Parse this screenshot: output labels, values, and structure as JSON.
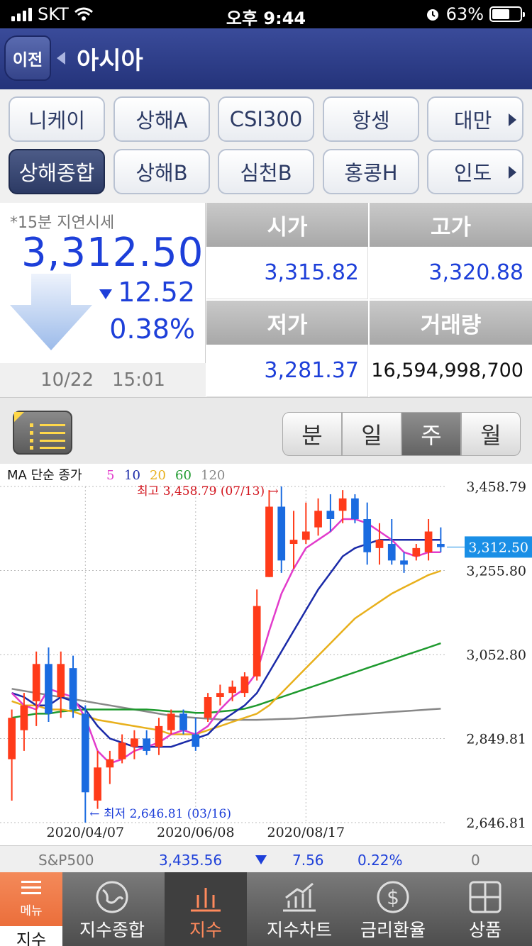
{
  "status_bar": {
    "carrier": "SKT",
    "time": "오후 9:44",
    "battery": "63%",
    "battery_level": 0.63
  },
  "header": {
    "back_label": "이전",
    "title": "아시아"
  },
  "market_tabs": [
    [
      "니케이",
      "상해A",
      "CSI300",
      "항셍",
      "대만"
    ],
    [
      "상해종합",
      "상해B",
      "심천B",
      "홍콩H",
      "인도"
    ]
  ],
  "quote": {
    "delay_note": "*15분 지연시세",
    "price": "3,312.50",
    "change": "12.52",
    "change_pct": "0.38%",
    "date": "10/22",
    "time": "15:01"
  },
  "quote_grid": {
    "open_label": "시가",
    "open": "3,315.82",
    "high_label": "고가",
    "high": "3,320.88",
    "low_label": "저가",
    "low": "3,281.37",
    "volume_label": "거래량",
    "volume": "16,594,998,700"
  },
  "chart_controls": {
    "periods": [
      "분",
      "일",
      "주",
      "월"
    ],
    "active_period": "주"
  },
  "chart_data": {
    "type": "candlestick",
    "legend_prefix": "MA 단순 종가",
    "ma_series": [
      {
        "name": "5",
        "color": "#e23bcb"
      },
      {
        "name": "10",
        "color": "#1a2aa8"
      },
      {
        "name": "20",
        "color": "#e8b01c"
      },
      {
        "name": "60",
        "color": "#1e9a2e"
      },
      {
        "name": "120",
        "color": "#888888"
      }
    ],
    "high_note": "최고 3,458.79 (07/13)",
    "low_note": "최저 2,646.81 (03/16)",
    "y_ticks": [
      "3,458.79",
      "3,255.80",
      "3,052.80",
      "2,849.81",
      "2,646.81"
    ],
    "y_tick_values": [
      3458.79,
      3255.8,
      3052.8,
      2849.81,
      2646.81
    ],
    "ylim": [
      2646.81,
      3458.79
    ],
    "x_ticks": [
      "2020/04/07",
      "2020/06/08",
      "2020/08/17"
    ],
    "x_tick_index": [
      6,
      15,
      24
    ],
    "current_label": "3,312.50",
    "current_value": 3312.5,
    "up_color": "#ff3b1a",
    "down_color": "#1a6be0",
    "candles": [
      {
        "o": 2800,
        "h": 2920,
        "l": 2700,
        "c": 2900
      },
      {
        "o": 2870,
        "h": 2960,
        "l": 2820,
        "c": 2930
      },
      {
        "o": 2940,
        "h": 3060,
        "l": 2880,
        "c": 3030
      },
      {
        "o": 3030,
        "h": 3070,
        "l": 2890,
        "c": 2910
      },
      {
        "o": 2950,
        "h": 3060,
        "l": 2900,
        "c": 3030
      },
      {
        "o": 3020,
        "h": 3050,
        "l": 2900,
        "c": 2920
      },
      {
        "o": 2910,
        "h": 2930,
        "l": 2646.81,
        "c": 2720
      },
      {
        "o": 2700,
        "h": 2820,
        "l": 2680,
        "c": 2780
      },
      {
        "o": 2780,
        "h": 2820,
        "l": 2740,
        "c": 2800
      },
      {
        "o": 2800,
        "h": 2860,
        "l": 2790,
        "c": 2840
      },
      {
        "o": 2830,
        "h": 2870,
        "l": 2800,
        "c": 2850
      },
      {
        "o": 2850,
        "h": 2870,
        "l": 2810,
        "c": 2820
      },
      {
        "o": 2830,
        "h": 2900,
        "l": 2810,
        "c": 2880
      },
      {
        "o": 2870,
        "h": 2920,
        "l": 2860,
        "c": 2910
      },
      {
        "o": 2910,
        "h": 2920,
        "l": 2860,
        "c": 2870
      },
      {
        "o": 2860,
        "h": 2900,
        "l": 2820,
        "c": 2830
      },
      {
        "o": 2900,
        "h": 2960,
        "l": 2890,
        "c": 2950
      },
      {
        "o": 2950,
        "h": 2980,
        "l": 2930,
        "c": 2960
      },
      {
        "o": 2960,
        "h": 2990,
        "l": 2940,
        "c": 2975
      },
      {
        "o": 2960,
        "h": 3010,
        "l": 2950,
        "c": 3000
      },
      {
        "o": 3000,
        "h": 3210,
        "l": 2990,
        "c": 3170
      },
      {
        "o": 3240,
        "h": 3450,
        "l": 3240,
        "c": 3410
      },
      {
        "o": 3410,
        "h": 3458.79,
        "l": 3250,
        "c": 3280
      },
      {
        "o": 3320,
        "h": 3400,
        "l": 3260,
        "c": 3330
      },
      {
        "o": 3330,
        "h": 3420,
        "l": 3320,
        "c": 3350
      },
      {
        "o": 3360,
        "h": 3430,
        "l": 3340,
        "c": 3400
      },
      {
        "o": 3400,
        "h": 3440,
        "l": 3350,
        "c": 3380
      },
      {
        "o": 3400,
        "h": 3450,
        "l": 3370,
        "c": 3430
      },
      {
        "o": 3430,
        "h": 3440,
        "l": 3370,
        "c": 3380
      },
      {
        "o": 3380,
        "h": 3420,
        "l": 3270,
        "c": 3300
      },
      {
        "o": 3310,
        "h": 3370,
        "l": 3270,
        "c": 3330
      },
      {
        "o": 3320,
        "h": 3380,
        "l": 3270,
        "c": 3280
      },
      {
        "o": 3280,
        "h": 3300,
        "l": 3250,
        "c": 3270
      },
      {
        "o": 3290,
        "h": 3320,
        "l": 3280,
        "c": 3310
      },
      {
        "o": 3300,
        "h": 3380,
        "l": 3280,
        "c": 3350
      },
      {
        "o": 3320,
        "h": 3360,
        "l": 3300,
        "c": 3312.5
      }
    ],
    "ma_lines": {
      "5": [
        2960,
        2930,
        2920,
        2970,
        2960,
        2950,
        2900,
        2820,
        2790,
        2800,
        2820,
        2830,
        2840,
        2860,
        2870,
        2860,
        2880,
        2920,
        2950,
        2970,
        3010,
        3110,
        3200,
        3260,
        3310,
        3330,
        3350,
        3380,
        3380,
        3370,
        3350,
        3330,
        3300,
        3290,
        3300,
        3300
      ],
      "10": [
        2960,
        2950,
        2930,
        2930,
        2950,
        2940,
        2920,
        2880,
        2850,
        2840,
        2830,
        2830,
        2830,
        2830,
        2840,
        2850,
        2860,
        2890,
        2910,
        2930,
        2960,
        3010,
        3060,
        3110,
        3160,
        3210,
        3250,
        3290,
        3310,
        3320,
        3330,
        3330,
        3330,
        3330,
        3330,
        3330
      ],
      "20": [
        2940,
        2930,
        2930,
        2920,
        2920,
        2915,
        2905,
        2895,
        2890,
        2885,
        2880,
        2875,
        2870,
        2860,
        2860,
        2860,
        2870,
        2880,
        2890,
        2900,
        2910,
        2930,
        2960,
        2990,
        3020,
        3050,
        3080,
        3110,
        3140,
        3160,
        3180,
        3200,
        3215,
        3230,
        3245,
        3255
      ],
      "60": [
        2900,
        2905,
        2910,
        2910,
        2915,
        2918,
        2920,
        2920,
        2920,
        2920,
        2920,
        2920,
        2918,
        2915,
        2915,
        2912,
        2912,
        2915,
        2918,
        2922,
        2930,
        2940,
        2950,
        2960,
        2970,
        2980,
        2990,
        3000,
        3010,
        3020,
        3030,
        3040,
        3050,
        3060,
        3070,
        3080
      ],
      "120": [
        2970,
        2965,
        2960,
        2955,
        2950,
        2945,
        2940,
        2935,
        2930,
        2925,
        2920,
        2915,
        2910,
        2905,
        2902,
        2900,
        2898,
        2896,
        2895,
        2895,
        2895,
        2896,
        2897,
        2898,
        2900,
        2902,
        2904,
        2906,
        2908,
        2910,
        2912,
        2914,
        2916,
        2918,
        2920,
        2922
      ]
    }
  },
  "ticker": {
    "name": "S&P500",
    "value": "3,435.56",
    "change": "7.56",
    "change_pct": "0.22%",
    "extra": "0"
  },
  "bottom_nav": {
    "menu_icon_label": "메뉴",
    "menu_label": "지수",
    "items": [
      "지수종합",
      "지수",
      "지수차트",
      "금리환율",
      "상품"
    ],
    "active": "지수"
  }
}
